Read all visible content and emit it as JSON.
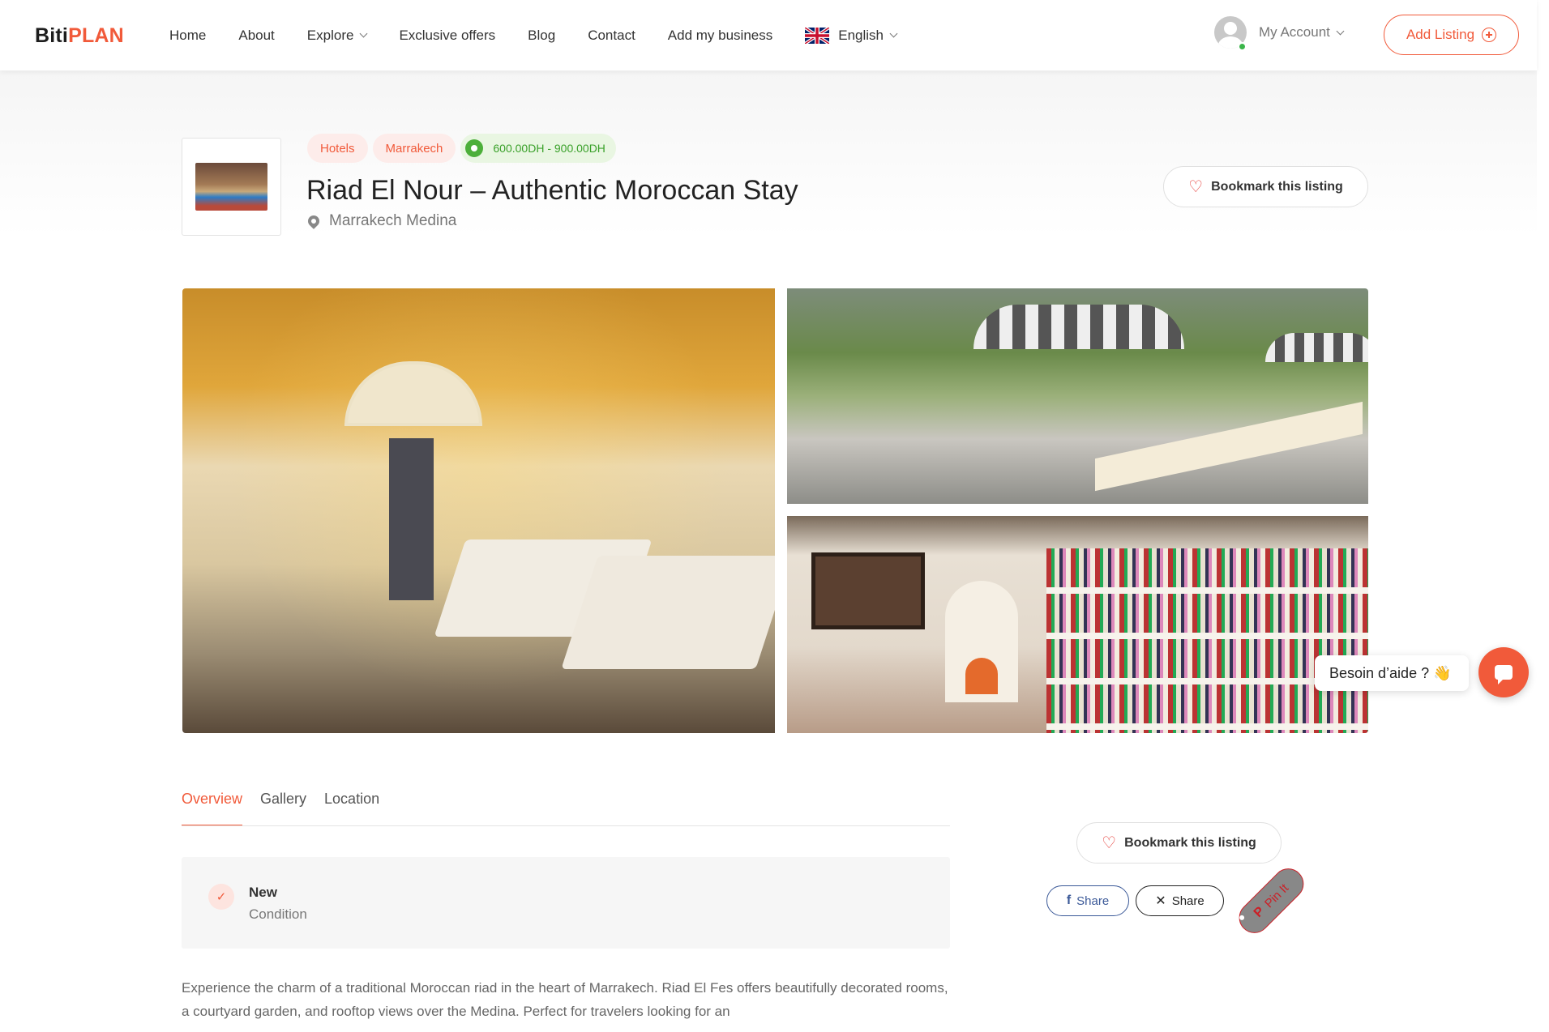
{
  "header": {
    "logo_part1": "Biti",
    "logo_part2": "PLAN",
    "nav": [
      "Home",
      "About",
      "Explore",
      "Exclusive offers",
      "Blog",
      "Contact",
      "Add my business"
    ],
    "language": "English",
    "account_label": "My Account",
    "add_listing_label": "Add Listing"
  },
  "listing": {
    "tags": [
      "Hotels",
      "Marrakech"
    ],
    "price_range": "600.00DH - 900.00DH",
    "title": "Riad El Nour – Authentic Moroccan Stay",
    "location": "Marrakech Medina",
    "bookmark_label": "Bookmark this listing"
  },
  "tabs": [
    "Overview",
    "Gallery",
    "Location"
  ],
  "condition": {
    "value": "New",
    "label": "Condition"
  },
  "description": "Experience the charm of a traditional Moroccan riad in the heart of Marrakech. Riad El Fes offers beautifully decorated rooms, a courtyard garden, and rooftop views over the Medina. Perfect for travelers looking for an",
  "sidebar": {
    "bookmark_label": "Bookmark this listing",
    "share_facebook": "Share",
    "share_x": "Share",
    "share_pinterest": "Pin It"
  },
  "chat": {
    "help_text": "Besoin d’aide ? 👋"
  },
  "colors": {
    "accent": "#f15a3a",
    "price_green": "#3aa12a"
  }
}
